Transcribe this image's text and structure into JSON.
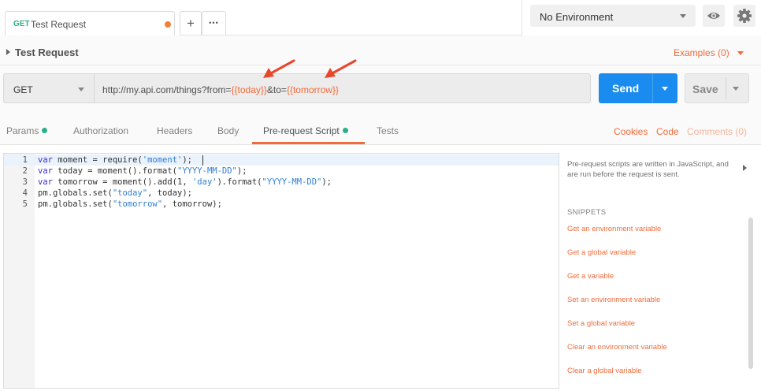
{
  "tabs": {
    "active": {
      "method": "GET",
      "name": "Test Request"
    },
    "add_label": "+",
    "more_label": "•••"
  },
  "environment": {
    "selected": "No Environment"
  },
  "request": {
    "name": "Test Request",
    "examples_label": "Examples (0)",
    "method": "GET",
    "url_prefix": "http://my.api.com/things?from=",
    "url_var1": "{{today}}",
    "url_mid": "&to=",
    "url_var2": "{{tomorrow}}",
    "send_label": "Send",
    "save_label": "Save"
  },
  "subtabs": {
    "params": "Params",
    "authorization": "Authorization",
    "headers": "Headers",
    "body": "Body",
    "prerequest": "Pre-request Script",
    "tests": "Tests",
    "cookies": "Cookies",
    "code": "Code",
    "comments": "Comments (0)"
  },
  "editor": {
    "lines": [
      {
        "n": "1",
        "parts": [
          [
            "kw",
            "var"
          ],
          [
            "t",
            " moment = require("
          ],
          [
            "str",
            "'moment'"
          ],
          [
            "t",
            ");"
          ]
        ]
      },
      {
        "n": "2",
        "parts": [
          [
            "kw",
            "var"
          ],
          [
            "t",
            " today = moment().format("
          ],
          [
            "str",
            "\"YYYY-MM-DD\""
          ],
          [
            "t",
            ");"
          ]
        ]
      },
      {
        "n": "3",
        "parts": [
          [
            "kw",
            "var"
          ],
          [
            "t",
            " tomorrow = moment().add(1, "
          ],
          [
            "str",
            "'day'"
          ],
          [
            "t",
            ").format("
          ],
          [
            "str",
            "\"YYYY-MM-DD\""
          ],
          [
            "t",
            ");"
          ]
        ]
      },
      {
        "n": "4",
        "parts": [
          [
            "t",
            "pm.globals.set("
          ],
          [
            "str",
            "\"today\""
          ],
          [
            "t",
            ", today);"
          ]
        ]
      },
      {
        "n": "5",
        "parts": [
          [
            "t",
            "pm.globals.set("
          ],
          [
            "str",
            "\"tomorrow\""
          ],
          [
            "t",
            ", tomorrow);"
          ]
        ]
      }
    ]
  },
  "panel": {
    "description": "Pre-request scripts are written in JavaScript, and are run before the request is sent.",
    "snippets_title": "SNIPPETS",
    "snippets": [
      "Get an environment variable",
      "Get a global variable",
      "Get a variable",
      "Set an environment variable",
      "Set a global variable",
      "Clear an environment variable",
      "Clear a global variable"
    ]
  },
  "colors": {
    "accent": "#f26b3a",
    "send": "#1a8cf0",
    "status_green": "#2ab089"
  }
}
